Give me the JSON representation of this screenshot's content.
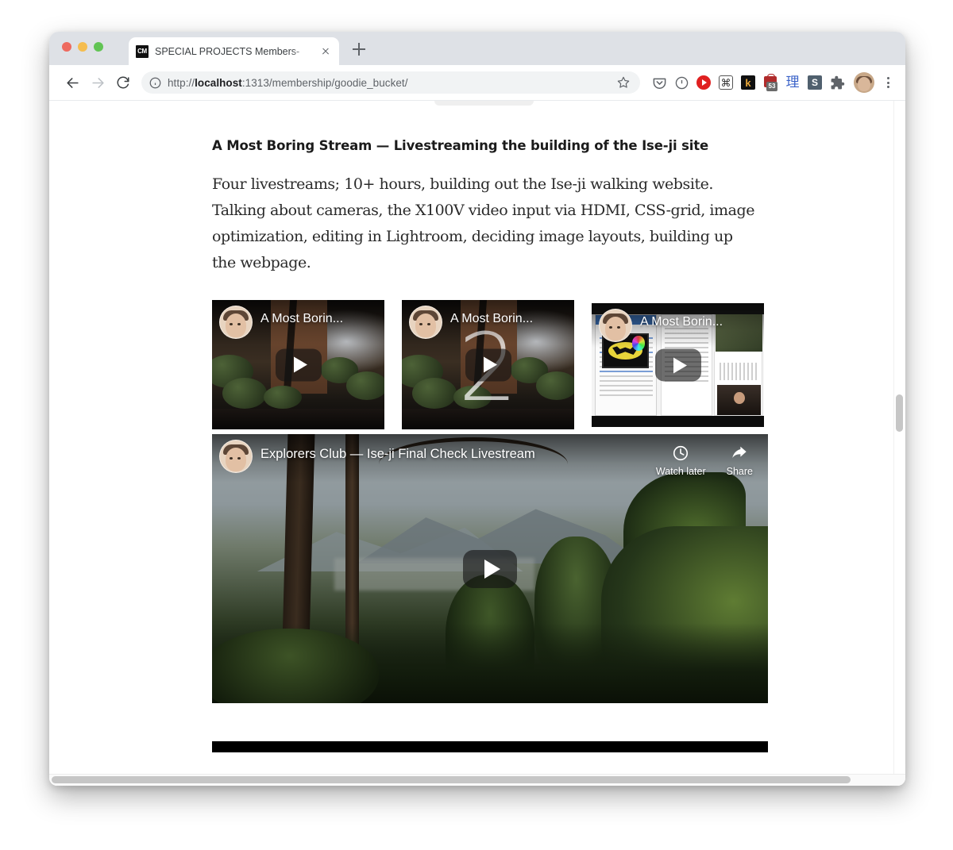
{
  "browser": {
    "tab": {
      "favicon_label": "CM",
      "title": "SPECIAL PROJECTS Members-",
      "close_icon": "close-icon"
    },
    "new_tab_label": "+",
    "nav": {
      "back_icon": "back-arrow-icon",
      "forward_icon": "forward-arrow-icon",
      "reload_icon": "reload-icon"
    },
    "omnibox": {
      "info_icon": "info-circle-icon",
      "url_scheme": "http://",
      "url_host": "localhost",
      "url_path": ":1313/membership/goodie_bucket/",
      "full_url": "http://localhost:1313/membership/goodie_bucket/",
      "bookmark_icon": "star-icon"
    },
    "extensions": [
      {
        "name": "pocket-icon",
        "label": ""
      },
      {
        "name": "info-icon",
        "label": ""
      },
      {
        "name": "youtube-icon",
        "label": ""
      },
      {
        "name": "command-key-icon",
        "label": "⌘"
      },
      {
        "name": "kagi-icon",
        "label": "k"
      },
      {
        "name": "shopping-bag-icon",
        "label": "",
        "badge": "53"
      },
      {
        "name": "kanji-icon",
        "label": "理"
      },
      {
        "name": "s-extension-icon",
        "label": "S"
      },
      {
        "name": "puzzle-piece-icon",
        "label": ""
      }
    ],
    "profile_icon": "avatar-icon",
    "menu_icon": "three-dot-menu-icon"
  },
  "page": {
    "heading": "A Most Boring Stream — Livestreaming the building of the Ise-ji site",
    "body": "Four livestreams; 10+ hours, building out the Ise-ji walking website. Talking about cameras, the X100V video input via HDMI, CSS-grid, image optimization, editing in Lightroom, deciding image layouts, building up the webpage.",
    "thumbnails": [
      {
        "title": "A Most Borin...",
        "episode": "",
        "scene": "japanese-garden",
        "play_icon": "play-icon"
      },
      {
        "title": "A Most Borin...",
        "episode": "2",
        "scene": "japanese-garden",
        "play_icon": "play-icon"
      },
      {
        "title": "A Most Borin...",
        "episode": "",
        "scene": "desktop-screenshare",
        "play_icon": "play-icon"
      }
    ],
    "featured_video": {
      "title": "Explorers Club — Ise-ji Final Check Livestream",
      "play_icon": "play-icon",
      "actions": [
        {
          "label": "Watch later",
          "icon": "clock-icon"
        },
        {
          "label": "Share",
          "icon": "share-arrow-icon"
        }
      ]
    }
  }
}
